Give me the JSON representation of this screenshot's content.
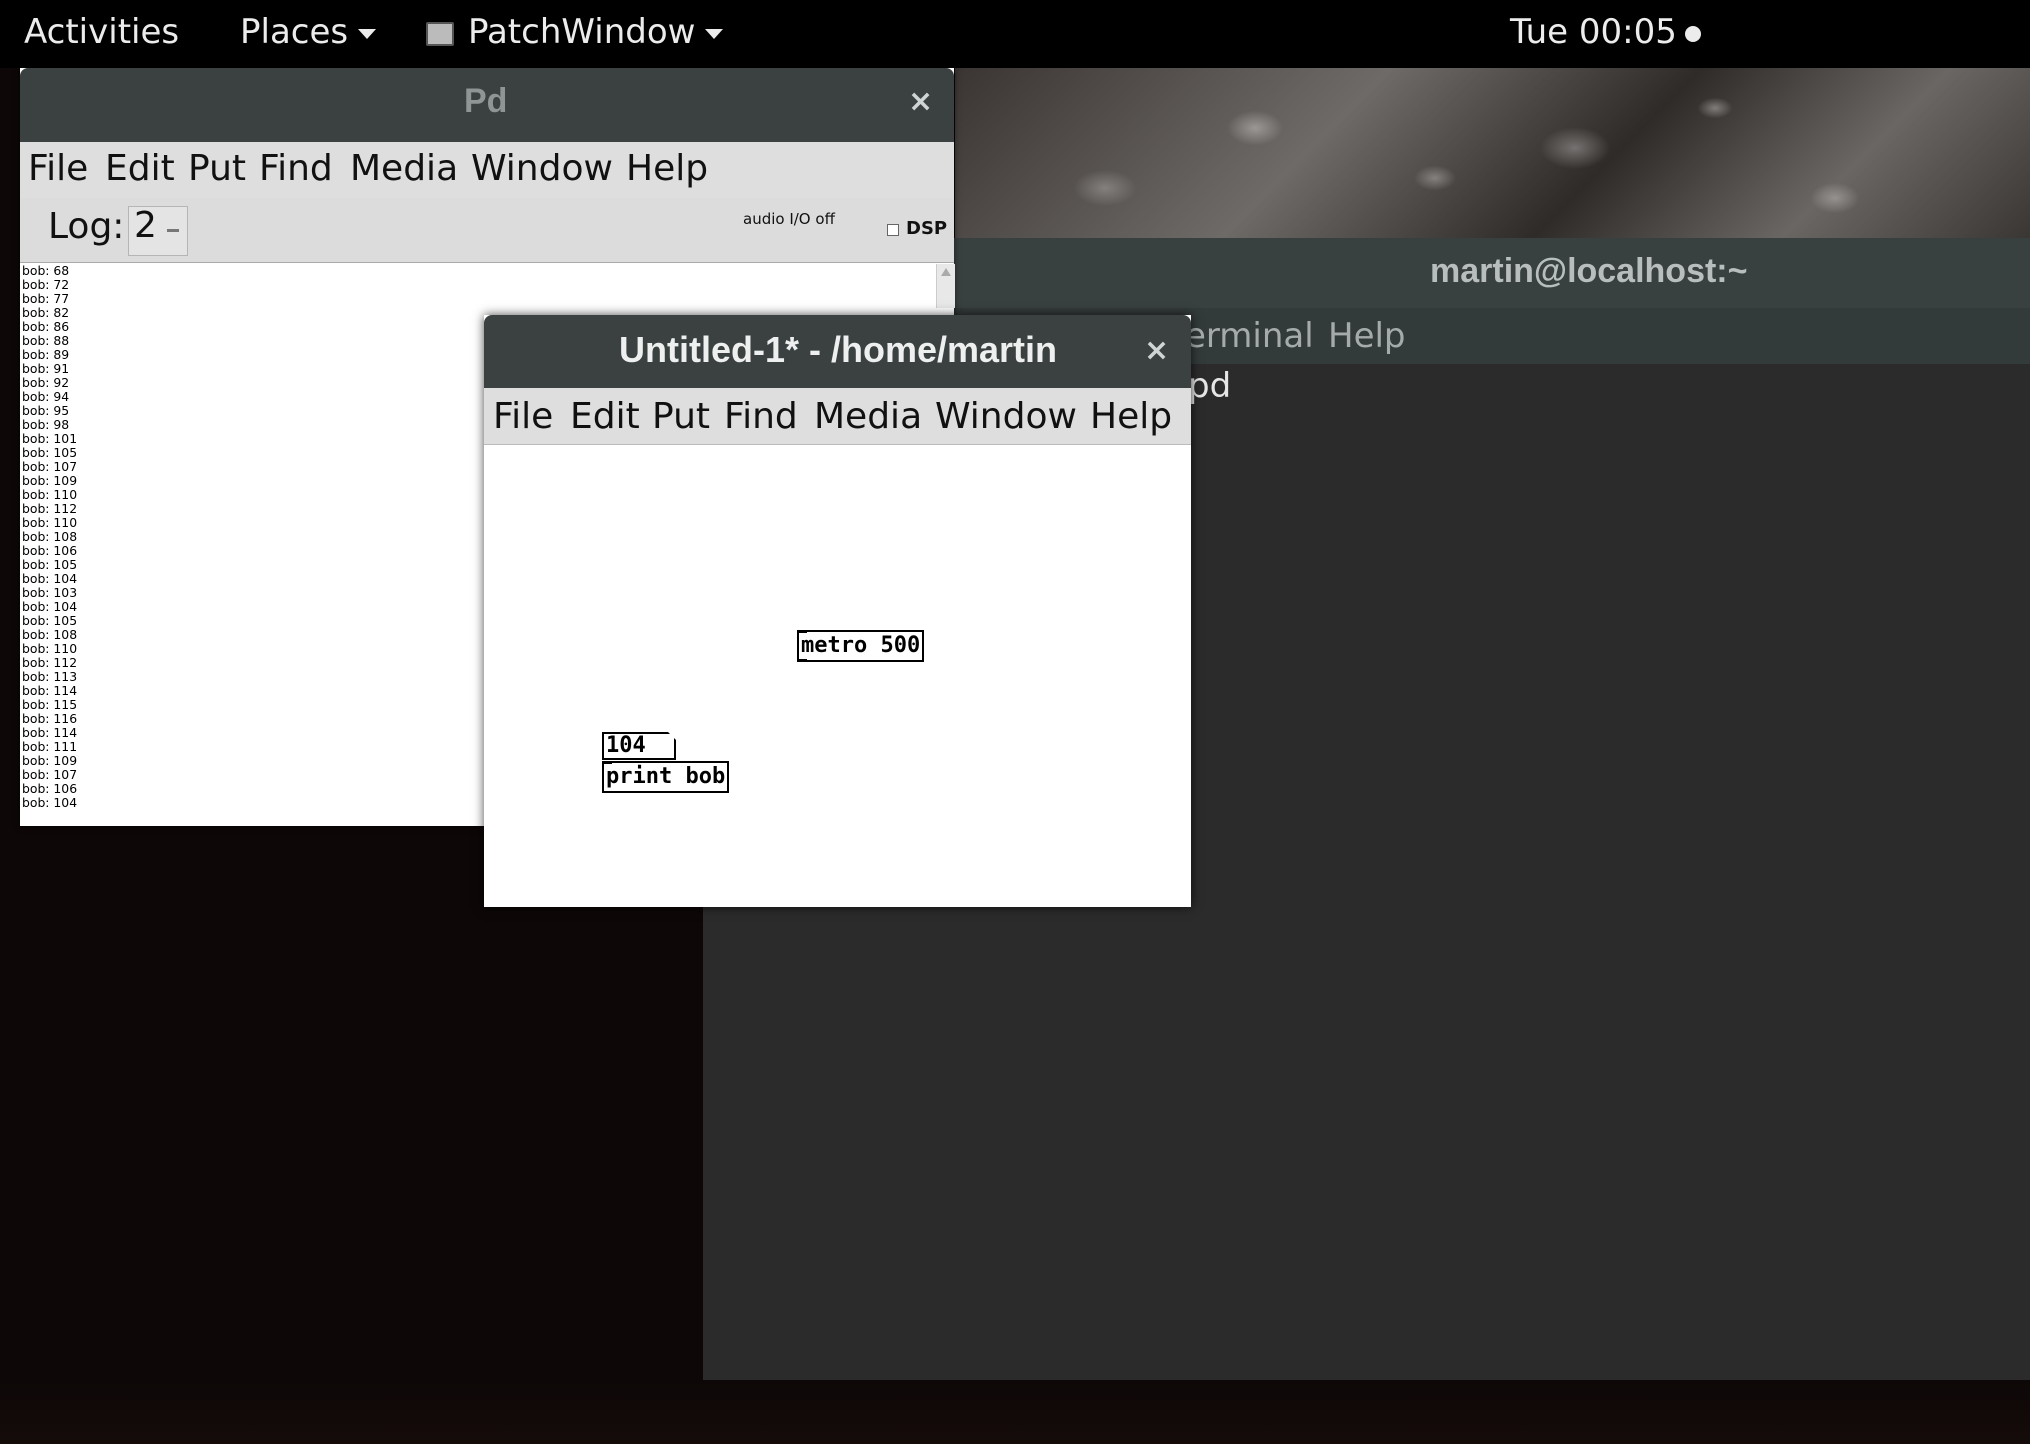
{
  "topbar": {
    "activities": "Activities",
    "places": "Places",
    "app_name": "PatchWindow",
    "clock": "Tue 00:05"
  },
  "terminal": {
    "title": "martin@localhost:~",
    "menu_terminal": "erminal",
    "menu_help": "Help",
    "content": "pd"
  },
  "pd_main": {
    "title": "Pd",
    "close": "×",
    "menu": [
      "File",
      "Edit",
      "Put",
      "Find",
      "Media",
      "Window",
      "Help"
    ],
    "log_label": "Log:",
    "log_value": "2",
    "audio_status": "audio I/O off",
    "dsp_label": "DSP",
    "dsp_checked": false,
    "console_lines": [
      "bob: 68",
      "bob: 72",
      "bob: 77",
      "bob: 82",
      "bob: 86",
      "bob: 88",
      "bob: 89",
      "bob: 91",
      "bob: 92",
      "bob: 94",
      "bob: 95",
      "bob: 98",
      "bob: 101",
      "bob: 105",
      "bob: 107",
      "bob: 109",
      "bob: 110",
      "bob: 112",
      "bob: 110",
      "bob: 108",
      "bob: 106",
      "bob: 105",
      "bob: 104",
      "bob: 103",
      "bob: 104",
      "bob: 105",
      "bob: 108",
      "bob: 110",
      "bob: 112",
      "bob: 113",
      "bob: 114",
      "bob: 115",
      "bob: 116",
      "bob: 114",
      "bob: 111",
      "bob: 109",
      "bob: 107",
      "bob: 106",
      "bob: 104"
    ]
  },
  "patch": {
    "title": "Untitled-1* - /home/martin",
    "close": "×",
    "menu": [
      "File",
      "Edit",
      "Put",
      "Find",
      "Media",
      "Window",
      "Help"
    ],
    "objects": {
      "metro": "metro 500",
      "number": "104",
      "print": "print bob"
    }
  }
}
